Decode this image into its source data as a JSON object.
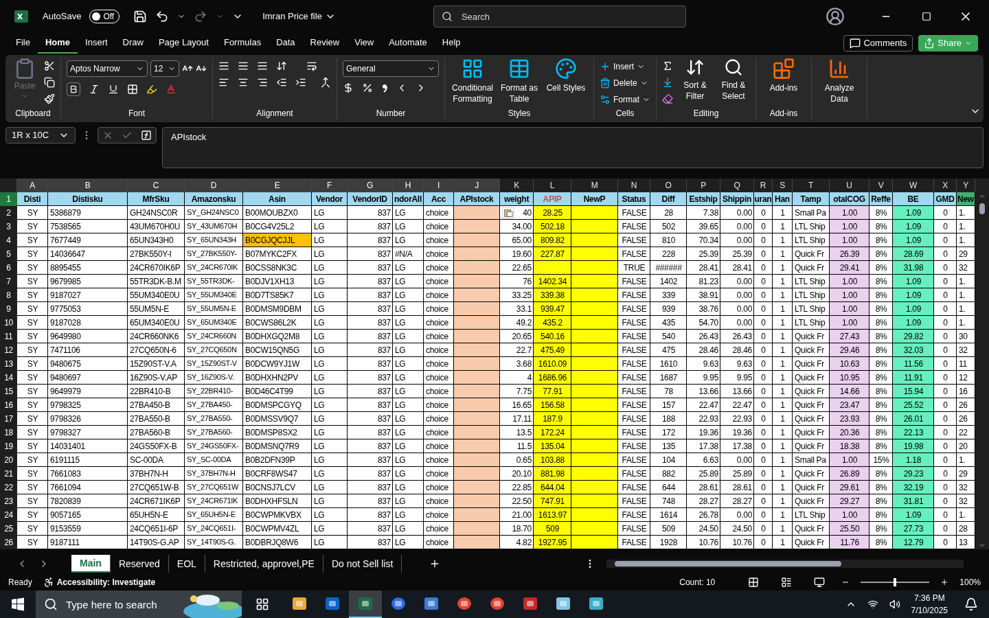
{
  "title_bar": {
    "autosave_label": "AutoSave",
    "autosave": {
      "on": false,
      "label": "Off"
    },
    "file_name": "Imran Price file",
    "search": {
      "placeholder": "Search"
    }
  },
  "menu_tabs": [
    {
      "label": "File",
      "selected": false
    },
    {
      "label": "Home",
      "selected": true
    },
    {
      "label": "Insert",
      "selected": false
    },
    {
      "label": "Draw",
      "selected": false
    },
    {
      "label": "Page Layout",
      "selected": false
    },
    {
      "label": "Formulas",
      "selected": false
    },
    {
      "label": "Data",
      "selected": false
    },
    {
      "label": "Review",
      "selected": false
    },
    {
      "label": "View",
      "selected": false
    },
    {
      "label": "Automate",
      "selected": false
    },
    {
      "label": "Help",
      "selected": false
    }
  ],
  "menu_actions": {
    "comments": "Comments",
    "share": "Share"
  },
  "ribbon": {
    "groups": [
      {
        "kind": "clipboard",
        "label": "Clipboard",
        "paste": {
          "label": "Paste",
          "disabled": true
        }
      },
      {
        "kind": "font",
        "label": "Font",
        "font": "Aptos Narrow",
        "size": "12"
      },
      {
        "kind": "alignment",
        "label": "Alignment"
      },
      {
        "kind": "number",
        "label": "Number",
        "format": "General"
      },
      {
        "kind": "large",
        "label": "Styles",
        "buttons": [
          "Conditional Formatting",
          "Format as Table",
          "Cell Styles"
        ]
      },
      {
        "kind": "cells",
        "label": "Cells",
        "buttons": [
          "Insert",
          "Delete",
          "Format"
        ]
      },
      {
        "kind": "editing",
        "label": "Editing",
        "buttons": [
          "Sort & Filter",
          "Find & Select"
        ]
      },
      {
        "kind": "large",
        "label": "Add-ins",
        "buttons": [
          "Add-ins"
        ]
      },
      {
        "kind": "large",
        "buttons": [
          "Analyze Data"
        ]
      }
    ]
  },
  "formula_bar": {
    "name_box": "1R x 10C",
    "formula": "APIstock"
  },
  "columns": [
    {
      "letter": "A",
      "header": {
        "label": "Disti",
        "color": "#9fd8ef"
      },
      "selected": true
    },
    {
      "letter": "B",
      "header": {
        "label": "Distisku",
        "color": "#9fd8ef"
      },
      "selected": true
    },
    {
      "letter": "C",
      "header": {
        "label": "MfrSku",
        "color": "#9fd8ef"
      },
      "selected": true
    },
    {
      "letter": "D",
      "header": {
        "label": "Amazonsku",
        "color": "#9fd8ef"
      },
      "selected": true
    },
    {
      "letter": "E",
      "header": {
        "label": "Asin",
        "color": "#9fd8ef"
      },
      "selected": true
    },
    {
      "letter": "F",
      "header": {
        "label": "Vendor",
        "color": "#9fd8ef"
      },
      "selected": true
    },
    {
      "letter": "G",
      "header": {
        "label": "VendorID",
        "color": "#9fd8ef"
      },
      "selected": true
    },
    {
      "letter": "H",
      "header": {
        "label": "ndorAll",
        "color": "#9fd8ef"
      },
      "selected": true
    },
    {
      "letter": "I",
      "header": {
        "label": "Acc",
        "color": "#9fd8ef"
      },
      "selected": true
    },
    {
      "letter": "J",
      "header": {
        "label": "APIstock",
        "color": "#9fd8ef"
      },
      "selected": true,
      "color": "#f8cbad"
    },
    {
      "letter": "K",
      "header": {
        "label": "weight",
        "color": "#9fd8ef"
      },
      "selected": false
    },
    {
      "letter": "L",
      "header": {
        "label": "APIP",
        "color": "#9fd8ef"
      },
      "selected": false,
      "color": "#ffff00"
    },
    {
      "letter": "M",
      "header": {
        "label": "NewP",
        "color": "#9fd8ef"
      },
      "selected": false,
      "color": "#ffff00"
    },
    {
      "letter": "N",
      "header": {
        "label": "Status",
        "color": "#9fd8ef"
      },
      "selected": false
    },
    {
      "letter": "O",
      "header": {
        "label": "Diff",
        "color": "#9fd8ef"
      },
      "selected": false
    },
    {
      "letter": "P",
      "header": {
        "label": "Estship",
        "color": "#9fd8ef"
      },
      "selected": false
    },
    {
      "letter": "Q",
      "header": {
        "label": "Shippin",
        "color": "#9fd8ef"
      },
      "selected": false
    },
    {
      "letter": "R",
      "header": {
        "label": "uran",
        "color": "#9fd8ef"
      },
      "selected": false
    },
    {
      "letter": "S",
      "header": {
        "label": "Han",
        "color": "#9fd8ef"
      },
      "selected": false
    },
    {
      "letter": "T",
      "header": {
        "label": "Tamp",
        "color": "#9fd8ef"
      },
      "selected": false
    },
    {
      "letter": "U",
      "header": {
        "label": "otalCOG",
        "color": "#9fd8ef"
      },
      "selected": false,
      "color": "#ead1ee"
    },
    {
      "letter": "V",
      "header": {
        "label": "Reffe",
        "color": "#9fd8ef"
      },
      "selected": false
    },
    {
      "letter": "W",
      "header": {
        "label": "BE",
        "color": "#9fd8ef"
      },
      "selected": false,
      "color": "#66f0c0"
    },
    {
      "letter": "X",
      "header": {
        "label": "GMD",
        "color": "#9fd8ef"
      },
      "selected": false
    },
    {
      "letter": "Y",
      "header": {
        "label": "New",
        "color": "#3cb371"
      },
      "selected": false
    }
  ],
  "header_row": {
    "number": "1",
    "selected": true
  },
  "rows": [
    {
      "number": "2",
      "selected": false,
      "flagged": false,
      "cells": [
        "SY",
        "5386879",
        "GH24NSC0R",
        "SY_GH24NSC0",
        "B00MOUBZX0",
        "LG",
        "837",
        "LG",
        "choice",
        null,
        "40",
        "28.25",
        null,
        "FALSE",
        "28",
        "7.38",
        "0.00",
        "0",
        "1",
        "Small Pa",
        "1.00",
        "8%",
        "1.09",
        "0",
        "1."
      ]
    },
    {
      "number": "3",
      "selected": false,
      "flagged": false,
      "cells": [
        "SY",
        "7538565",
        "43UM670H0U",
        "SY_43UM670H",
        "B0CG4V25L2",
        "LG",
        "837",
        "LG",
        "choice",
        null,
        "34.00",
        "502.18",
        null,
        "FALSE",
        "502",
        "39.65",
        "0.00",
        "0",
        "1",
        "LTL Ship",
        "1.00",
        "8%",
        "1.09",
        "0",
        "1."
      ]
    },
    {
      "number": "4",
      "selected": false,
      "flagged": true,
      "cells": [
        "SY",
        "7677449",
        "65UN343H0",
        "SY_65UN343H",
        "B0CGJQCJJL",
        "LG",
        "837",
        "LG",
        "choice",
        null,
        "65.00",
        "809.82",
        null,
        "FALSE",
        "810",
        "70.34",
        "0.00",
        "0",
        "1",
        "LTL Ship",
        "1.00",
        "8%",
        "1.09",
        "0",
        "1."
      ]
    },
    {
      "number": "5",
      "selected": false,
      "flagged": false,
      "cells": [
        "SY",
        "14036647",
        "27BK550Y-I",
        "SY_27BK550Y-",
        "B07MYKC2FX",
        "LG",
        "837",
        "#N/A",
        "choice",
        null,
        "19.60",
        "227.87",
        null,
        "FALSE",
        "228",
        "25.39",
        "25.39",
        "0",
        "1",
        "Quick Fr",
        "26.39",
        "8%",
        "28.69",
        "0",
        "29"
      ]
    },
    {
      "number": "6",
      "selected": false,
      "flagged": false,
      "cells": [
        "SY",
        "8895455",
        "24CR670IK6P",
        "SY_24CR670IK",
        "B0CSS8NK3C",
        "LG",
        "837",
        "LG",
        "choice",
        null,
        "22.65",
        null,
        null,
        "TRUE",
        "######",
        "28.41",
        "28.41",
        "0",
        "1",
        "Quick Fr",
        "29.41",
        "8%",
        "31.98",
        "0",
        "32"
      ]
    },
    {
      "number": "7",
      "selected": false,
      "flagged": false,
      "cells": [
        "SY",
        "9679985",
        "55TR3DK-B.M",
        "SY_55TR3DK-",
        "B0DJV1XH13",
        "LG",
        "837",
        "LG",
        "choice",
        null,
        "76",
        "1402.34",
        null,
        "FALSE",
        "1402",
        "81.23",
        "0.00",
        "0",
        "1",
        "LTL Ship",
        "1.00",
        "8%",
        "1.09",
        "0",
        "1."
      ]
    },
    {
      "number": "8",
      "selected": false,
      "flagged": false,
      "cells": [
        "SY",
        "9187027",
        "55UM340E0U",
        "SY_55UM340E",
        "B0D7TS85K7",
        "LG",
        "837",
        "LG",
        "choice",
        null,
        "33.25",
        "339.38",
        null,
        "FALSE",
        "339",
        "38.91",
        "0.00",
        "0",
        "1",
        "LTL Ship",
        "1.00",
        "8%",
        "1.09",
        "0",
        "1."
      ]
    },
    {
      "number": "9",
      "selected": false,
      "flagged": false,
      "cells": [
        "SY",
        "9775053",
        "55UM5N-E",
        "SY_55UM5N-E",
        "B0DMSM9DBM",
        "LG",
        "837",
        "LG",
        "choice",
        null,
        "33.1",
        "939.47",
        null,
        "FALSE",
        "939",
        "38.76",
        "0.00",
        "0",
        "1",
        "LTL Ship",
        "1.00",
        "8%",
        "1.09",
        "0",
        "1."
      ]
    },
    {
      "number": "10",
      "selected": false,
      "flagged": false,
      "cells": [
        "SY",
        "9187028",
        "65UM340E0U",
        "SY_65UM340E",
        "B0CWS86L2K",
        "LG",
        "837",
        "LG",
        "choice",
        null,
        "49.2",
        "435.2",
        null,
        "FALSE",
        "435",
        "54.70",
        "0.00",
        "0",
        "1",
        "LTL Ship",
        "1.00",
        "8%",
        "1.09",
        "0",
        "1."
      ]
    },
    {
      "number": "11",
      "selected": false,
      "flagged": false,
      "cells": [
        "SY",
        "9649980",
        "24CR660NK6",
        "SY_24CR660N",
        "B0DHXGQ2M8",
        "LG",
        "837",
        "LG",
        "choice",
        null,
        "20.65",
        "540.16",
        null,
        "FALSE",
        "540",
        "26.43",
        "26.43",
        "0",
        "1",
        "Quick Fr",
        "27.43",
        "8%",
        "29.82",
        "0",
        "30"
      ]
    },
    {
      "number": "12",
      "selected": false,
      "flagged": false,
      "cells": [
        "SY",
        "7471106",
        "27CQ650N-6",
        "SY_27CQ650N",
        "B0CW15QN5G",
        "LG",
        "837",
        "LG",
        "choice",
        null,
        "22.7",
        "475.49",
        null,
        "FALSE",
        "475",
        "28.46",
        "28.46",
        "0",
        "1",
        "Quick Fr",
        "29.46",
        "8%",
        "32.03",
        "0",
        "32"
      ]
    },
    {
      "number": "13",
      "selected": false,
      "flagged": false,
      "cells": [
        "SY",
        "9480675",
        "15Z90ST-V.A",
        "SY_15Z90ST-V",
        "B0DCW9YJ1W",
        "LG",
        "837",
        "LG",
        "choice",
        null,
        "3.68",
        "1610.09",
        null,
        "FALSE",
        "1610",
        "9.63",
        "9.63",
        "0",
        "1",
        "Quick Fr",
        "10.63",
        "8%",
        "11.56",
        "0",
        "11"
      ]
    },
    {
      "number": "14",
      "selected": false,
      "flagged": false,
      "cells": [
        "SY",
        "9480697",
        "16Z90S-V.AP",
        "SY_16Z90S-V.",
        "B0DHXHN2PV",
        "LG",
        "837",
        "LG",
        "choice",
        null,
        "4",
        "1686.96",
        null,
        "FALSE",
        "1687",
        "9.95",
        "9.95",
        "0",
        "1",
        "Quick Fr",
        "10.95",
        "8%",
        "11.91",
        "0",
        "12"
      ]
    },
    {
      "number": "15",
      "selected": false,
      "flagged": false,
      "cells": [
        "SY",
        "9649979",
        "22BR410-B",
        "SY_22BR410-",
        "B0D46C4T99",
        "LG",
        "837",
        "LG",
        "choice",
        null,
        "7.75",
        "77.91",
        null,
        "FALSE",
        "78",
        "13.66",
        "13.66",
        "0",
        "1",
        "Quick Fr",
        "14.66",
        "8%",
        "15.94",
        "0",
        "16"
      ]
    },
    {
      "number": "16",
      "selected": false,
      "flagged": false,
      "cells": [
        "SY",
        "9798325",
        "27BA450-B",
        "SY_27BA450-",
        "B0DMSPCGYQ",
        "LG",
        "837",
        "LG",
        "choice",
        null,
        "16.65",
        "156.58",
        null,
        "FALSE",
        "157",
        "22.47",
        "22.47",
        "0",
        "1",
        "Quick Fr",
        "23.47",
        "8%",
        "25.52",
        "0",
        "26"
      ]
    },
    {
      "number": "17",
      "selected": false,
      "flagged": false,
      "cells": [
        "SY",
        "9798326",
        "27BA550-B",
        "SY_27BA550-",
        "B0DMSSV9Q7",
        "LG",
        "837",
        "LG",
        "choice",
        null,
        "17.11",
        "187.9",
        null,
        "FALSE",
        "188",
        "22.93",
        "22.93",
        "0",
        "1",
        "Quick Fr",
        "23.93",
        "8%",
        "26.01",
        "0",
        "26"
      ]
    },
    {
      "number": "18",
      "selected": false,
      "flagged": false,
      "cells": [
        "SY",
        "9798327",
        "27BA560-B",
        "SY_27BA560-",
        "B0DMSP8SX2",
        "LG",
        "837",
        "LG",
        "choice",
        null,
        "13.5",
        "172.24",
        null,
        "FALSE",
        "172",
        "19.36",
        "19.36",
        "0",
        "1",
        "Quick Fr",
        "20.36",
        "8%",
        "22.13",
        "0",
        "22"
      ]
    },
    {
      "number": "19",
      "selected": false,
      "flagged": false,
      "cells": [
        "SY",
        "14031401",
        "24GS50FX-B",
        "SY_24GS50FX-",
        "B0DMSNQ7R9",
        "LG",
        "837",
        "LG",
        "choice",
        null,
        "11.5",
        "135.04",
        null,
        "FALSE",
        "135",
        "17.38",
        "17.38",
        "0",
        "1",
        "Quick Fr",
        "18.38",
        "8%",
        "19.98",
        "0",
        "20"
      ]
    },
    {
      "number": "20",
      "selected": false,
      "flagged": false,
      "cells": [
        "SY",
        "6191115",
        "SC-00DA",
        "SY_SC-00DA",
        "B0B2DFN39P",
        "LG",
        "837",
        "LG",
        "choice",
        null,
        "0.65",
        "103.88",
        null,
        "FALSE",
        "104",
        "6.63",
        "0.00",
        "0",
        "1",
        "Small Pa",
        "1.00",
        "15%",
        "1.18",
        "0",
        "1."
      ]
    },
    {
      "number": "21",
      "selected": false,
      "flagged": false,
      "cells": [
        "SY",
        "7661083",
        "37BH7N-H",
        "SY_37BH7N-H",
        "B0CRF8WS47",
        "LG",
        "837",
        "LG",
        "choice",
        null,
        "20.10",
        "881.98",
        null,
        "FALSE",
        "882",
        "25.89",
        "25.89",
        "0",
        "1",
        "Quick Fr",
        "26.89",
        "8%",
        "29.23",
        "0",
        "29"
      ]
    },
    {
      "number": "22",
      "selected": false,
      "flagged": false,
      "cells": [
        "SY",
        "7661094",
        "27CQ651W-B",
        "SY_27CQ651W",
        "B0CNSJ7LCV",
        "LG",
        "837",
        "LG",
        "choice",
        null,
        "22.85",
        "644.04",
        null,
        "FALSE",
        "644",
        "28.61",
        "28.61",
        "0",
        "1",
        "Quick Fr",
        "29.61",
        "8%",
        "32.19",
        "0",
        "32"
      ]
    },
    {
      "number": "23",
      "selected": false,
      "flagged": false,
      "cells": [
        "SY",
        "7820839",
        "24CR671IK6P",
        "SY_24CR671IK",
        "B0DHXHFSLN",
        "LG",
        "837",
        "LG",
        "choice",
        null,
        "22.50",
        "747.91",
        null,
        "FALSE",
        "748",
        "28.27",
        "28.27",
        "0",
        "1",
        "Quick Fr",
        "29.27",
        "8%",
        "31.81",
        "0",
        "32"
      ]
    },
    {
      "number": "24",
      "selected": false,
      "flagged": false,
      "cells": [
        "SY",
        "9057165",
        "65UH5N-E",
        "SY_65UH5N-E",
        "B0CWPMKVBX",
        "LG",
        "837",
        "LG",
        "choice",
        null,
        "21.00",
        "1613.97",
        null,
        "FALSE",
        "1614",
        "26.78",
        "0.00",
        "0",
        "1",
        "LTL Ship",
        "1.00",
        "8%",
        "1.09",
        "0",
        "1."
      ]
    },
    {
      "number": "25",
      "selected": false,
      "flagged": false,
      "cells": [
        "SY",
        "9153559",
        "24CQ651I-6P",
        "SY_24CQ651I-",
        "B0CWPMV4ZL",
        "LG",
        "837",
        "LG",
        "choice",
        null,
        "18.70",
        "509",
        null,
        "FALSE",
        "509",
        "24.50",
        "24.50",
        "0",
        "1",
        "Quick Fr",
        "25.50",
        "8%",
        "27.73",
        "0",
        "28"
      ]
    },
    {
      "number": "26",
      "selected": false,
      "flagged": false,
      "cells": [
        "SY",
        "9187111",
        "14T90S-G.AP",
        "SY_14T90S-G.",
        "B0DBRJQ8W6",
        "LG",
        "837",
        "LG",
        "choice",
        null,
        "4.82",
        "1927.95",
        null,
        "FALSE",
        "1928",
        "10.76",
        "10.76",
        "0",
        "1",
        "Quick Fr",
        "11.76",
        "8%",
        "12.79",
        "0",
        "13"
      ]
    }
  ],
  "sheet_tabs": [
    {
      "label": "Main",
      "selected": true
    },
    {
      "label": "Reserved",
      "selected": false
    },
    {
      "label": "EOL",
      "selected": false
    },
    {
      "label": "Restricted, approvel,PE",
      "selected": false
    },
    {
      "label": "Do not Sell list",
      "selected": false
    }
  ],
  "status_bar": {
    "mode": "Ready",
    "accessibility": "Accessibility: Investigate",
    "count": "Count: 10",
    "zoom": {
      "level": 0.5,
      "label": "100%"
    }
  },
  "taskbar": {
    "search": {
      "placeholder": "Type here to search"
    },
    "time": "7:36 PM",
    "date": "7/10/2025"
  }
}
